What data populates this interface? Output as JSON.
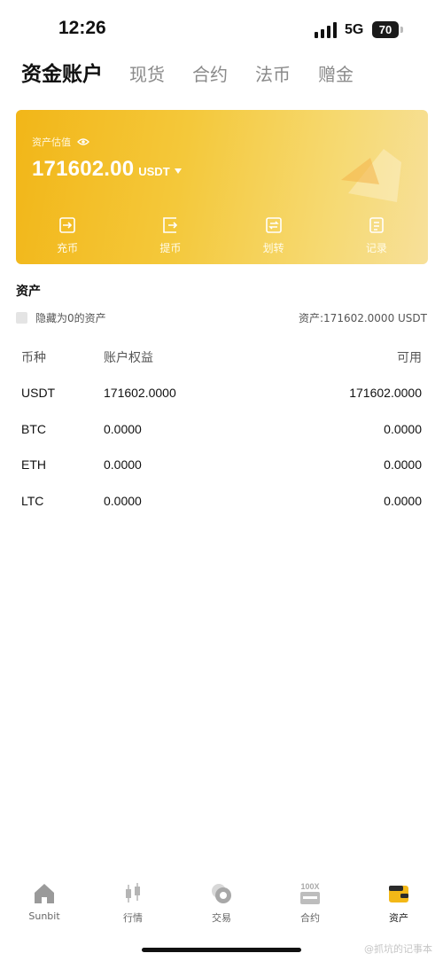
{
  "status_bar": {
    "time": "12:26",
    "network": "5G",
    "battery": "70"
  },
  "tabs": [
    {
      "label": "资金账户",
      "active": true
    },
    {
      "label": "现货",
      "active": false
    },
    {
      "label": "合约",
      "active": false
    },
    {
      "label": "法币",
      "active": false
    },
    {
      "label": "赠金",
      "active": false
    }
  ],
  "card": {
    "estimate_label": "资产估值",
    "balance": "171602.00",
    "unit": "USDT",
    "actions": [
      {
        "label": "充币",
        "icon": "deposit-icon"
      },
      {
        "label": "提币",
        "icon": "withdraw-icon"
      },
      {
        "label": "划转",
        "icon": "transfer-icon"
      },
      {
        "label": "记录",
        "icon": "record-icon"
      }
    ]
  },
  "assets": {
    "title": "资产",
    "hide_zero_label": "隐藏为0的资产",
    "total": "资产:171602.0000 USDT",
    "columns": [
      "币种",
      "账户权益",
      "可用"
    ],
    "rows": [
      {
        "coin": "USDT",
        "equity": "171602.0000",
        "available": "171602.0000"
      },
      {
        "coin": "BTC",
        "equity": "0.0000",
        "available": "0.0000"
      },
      {
        "coin": "ETH",
        "equity": "0.0000",
        "available": "0.0000"
      },
      {
        "coin": "LTC",
        "equity": "0.0000",
        "available": "0.0000"
      }
    ]
  },
  "bottom_nav": [
    {
      "label": "Sunbit",
      "icon": "home-icon"
    },
    {
      "label": "行情",
      "icon": "candlestick-icon"
    },
    {
      "label": "交易",
      "icon": "trade-icon"
    },
    {
      "label": "合约",
      "icon": "contract-100x-icon",
      "badge": "100X"
    },
    {
      "label": "资产",
      "icon": "wallet-icon",
      "active": true
    }
  ],
  "watermark": "@抓坑的记事本",
  "colors": {
    "card_start": "#f2b618",
    "card_end": "#f7e09a",
    "accent": "#f3b817"
  }
}
